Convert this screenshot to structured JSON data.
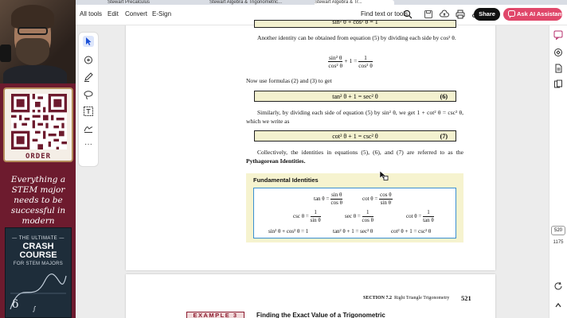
{
  "promo": {
    "order_label": "ORDER",
    "tagline": "Everything a STEM major needs to be successful in modern education",
    "book_top": "— THE ULTIMATE —",
    "book_title": "CRASH COURSE",
    "book_subtitle": "FOR STEM MAJORS"
  },
  "tabs": [
    {
      "label": "Stewart Precalculus"
    },
    {
      "label": "Stewart Algebra & Trigonometric..."
    },
    {
      "label": "Stewart Algebra & Tr..."
    }
  ],
  "toolbar": {
    "all_tools": "All tools",
    "edit": "Edit",
    "convert": "Convert",
    "esign": "E-Sign",
    "find": "Find text or tools",
    "share": "Share",
    "ai_assistant": "Ask AI Assistant"
  },
  "doc": {
    "top_partial": "sin² θ + cos² θ = 1",
    "para1": "Another identity can be obtained from equation (5) by dividing each side by cos² θ.",
    "eq_display_num_a": "sin² θ",
    "eq_display_den_a": "cos² θ",
    "eq_display_plus": "+ 1 =",
    "eq_display_num_b": "1",
    "eq_display_den_b": "cos² θ",
    "para2": "Now use formulas (2) and (3) to get",
    "eq6": "tan² θ + 1 = sec² θ",
    "eq6_num": "(6)",
    "para3": "Similarly, by dividing each side of equation (5) by sin² θ, we get 1 + cot² θ = csc² θ, which we write as",
    "eq7": "cot² θ + 1 = csc² θ",
    "eq7_num": "(7)",
    "para4_a": "Collectively, the identities in equations (5), (6), and (7) are referred to as the",
    "para4_b": "Pythagorean Identities."
  },
  "fundamental": {
    "title": "Fundamental Identities",
    "tan_lhs": "tan θ =",
    "tan_num": "sin θ",
    "tan_den": "cos θ",
    "cot_lhs": "cot θ =",
    "cot_num": "cos θ",
    "cot_den": "sin θ",
    "csc_lhs": "csc θ =",
    "csc_num": "1",
    "csc_den": "sin θ",
    "sec_lhs": "sec θ =",
    "sec_num": "1",
    "sec_den": "cos θ",
    "cot2_lhs": "cot θ =",
    "cot2_num": "1",
    "cot2_den": "tan θ",
    "pyth1": "sin² θ + cos² θ = 1",
    "pyth2": "tan² θ + 1 = sec² θ",
    "pyth3": "cot² θ + 1 = csc² θ"
  },
  "footer": {
    "section": "SECTION 7.2",
    "section_title": "Right Triangle Trigonometry",
    "page": "521",
    "example_label": "EXAMPLE 3",
    "example_title": "Finding the Exact Value of a Trigonometric"
  },
  "rail": {
    "page_current": "520",
    "page_total": "1175"
  },
  "colors": {
    "promo_bg": "#6d1b2e",
    "ai_button": "#e0476a",
    "box_fill": "#f3f1cf",
    "identity_border": "#3a8fd1"
  }
}
